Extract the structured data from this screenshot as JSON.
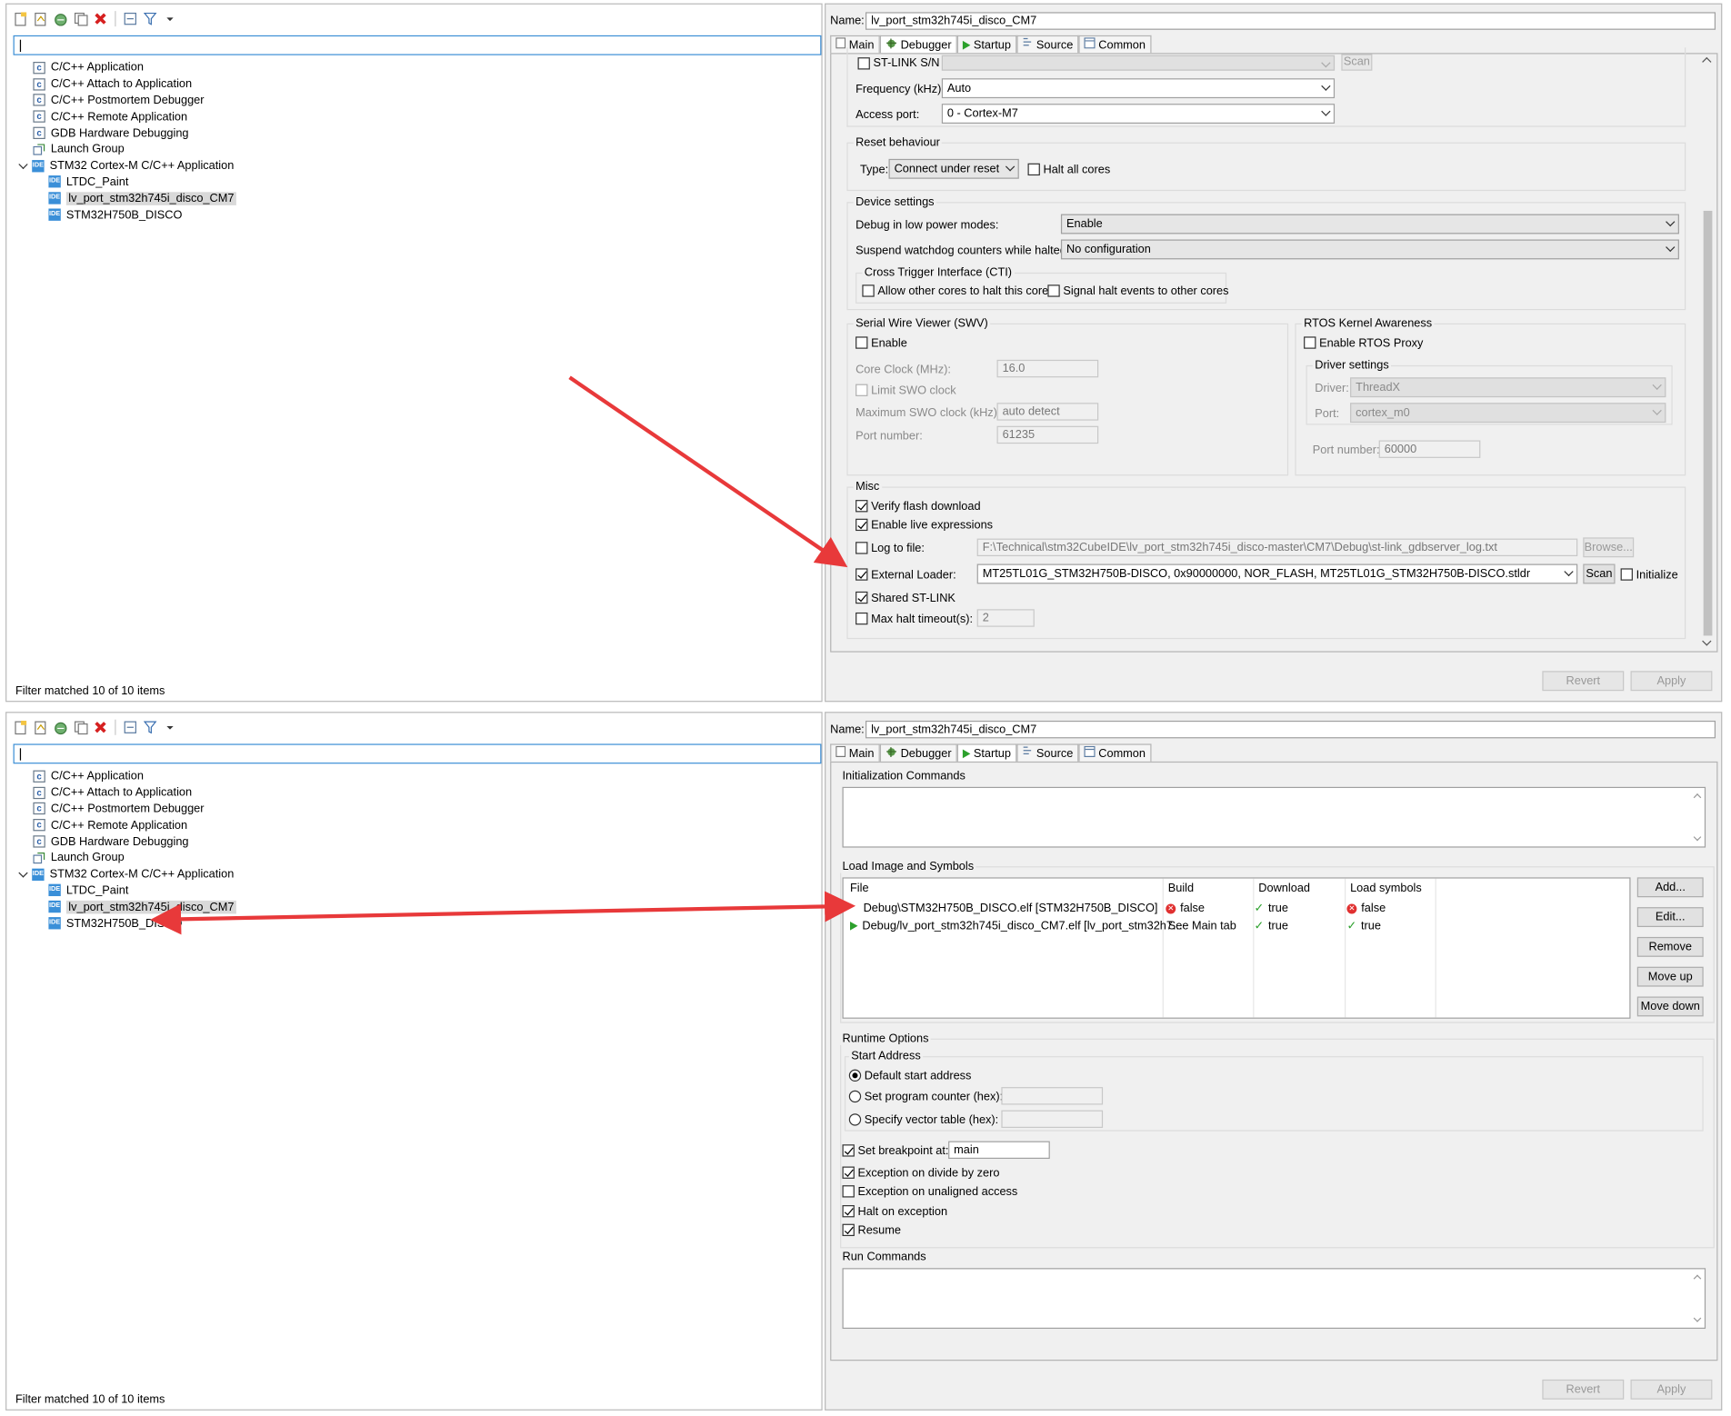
{
  "tree": {
    "items": [
      {
        "label": "C/C++ Application",
        "icon": "c-icon"
      },
      {
        "label": "C/C++ Attach to Application",
        "icon": "c-icon"
      },
      {
        "label": "C/C++ Postmortem Debugger",
        "icon": "c-icon"
      },
      {
        "label": "C/C++ Remote Application",
        "icon": "c-icon"
      },
      {
        "label": "GDB Hardware Debugging",
        "icon": "c-icon"
      },
      {
        "label": "Launch Group",
        "icon": "launch-group-icon"
      },
      {
        "label": "STM32 Cortex-M C/C++ Application",
        "icon": "ide-icon"
      },
      {
        "label": "LTDC_Paint",
        "icon": "ide-icon"
      },
      {
        "label": "lv_port_stm32h745i_disco_CM7",
        "icon": "ide-icon"
      },
      {
        "label": "STM32H750B_DISCO",
        "icon": "ide-icon"
      }
    ],
    "footer": "Filter matched 10 of 10 items"
  },
  "config": {
    "name_label": "Name:",
    "name_value": "lv_port_stm32h745i_disco_CM7",
    "tabs": [
      "Main",
      "Debugger",
      "Startup",
      "Source",
      "Common"
    ],
    "revert": "Revert",
    "apply": "Apply"
  },
  "debugger": {
    "stlink_sn": "ST-LINK S/N",
    "scan": "Scan",
    "frequency_label": "Frequency (kHz):",
    "frequency_value": "Auto",
    "access_port_label": "Access port:",
    "access_port_value": "0 - Cortex-M7",
    "reset_group": "Reset behaviour",
    "type_label": "Type:",
    "type_value": "Connect under reset",
    "halt_all": "Halt all cores",
    "device_group": "Device settings",
    "low_power_label": "Debug in low power modes:",
    "low_power_value": "Enable",
    "watchdog_label": "Suspend watchdog counters while halted:",
    "watchdog_value": "No configuration",
    "cti_group": "Cross Trigger Interface (CTI)",
    "cti_allow": "Allow other cores to halt this core",
    "cti_signal": "Signal halt events to other cores",
    "swv_group": "Serial Wire Viewer (SWV)",
    "swv_enable": "Enable",
    "core_clock_label": "Core Clock (MHz):",
    "core_clock_value": "16.0",
    "limit_swo": "Limit SWO clock",
    "max_swo_label": "Maximum SWO clock (kHz):",
    "max_swo_value": "auto detect",
    "port_number_label": "Port number:",
    "port_number_value": "61235",
    "rtos_group": "RTOS Kernel Awareness",
    "rtos_enable": "Enable RTOS Proxy",
    "driver_group": "Driver settings",
    "driver_label": "Driver:",
    "driver_value": "ThreadX",
    "port_label": "Port:",
    "port_value": "cortex_m0",
    "rtos_port_label": "Port number:",
    "rtos_port_value": "60000",
    "misc_group": "Misc",
    "verify_flash": "Verify flash download",
    "live_expr": "Enable live expressions",
    "log_to_file": "Log to file:",
    "log_path": "F:\\Technical\\stm32CubeIDE\\lv_port_stm32h745i_disco-master\\CM7\\Debug\\st-link_gdbserver_log.txt",
    "browse": "Browse...",
    "ext_loader": "External Loader:",
    "ext_loader_value": "MT25TL01G_STM32H750B-DISCO, 0x90000000, NOR_FLASH, MT25TL01G_STM32H750B-DISCO.stldr",
    "initialize": "Initialize",
    "shared_stlink": "Shared ST-LINK",
    "max_halt": "Max halt timeout(s):",
    "max_halt_value": "2"
  },
  "startup": {
    "init_cmds": "Initialization Commands",
    "load_group": "Load Image and Symbols",
    "cols": [
      "File",
      "Build",
      "Download",
      "Load symbols"
    ],
    "rows": [
      {
        "file": "Debug\\STM32H750B_DISCO.elf [STM32H750B_DISCO]",
        "build": "false",
        "download": "true",
        "symbols": "false"
      },
      {
        "file": "Debug/lv_port_stm32h745i_disco_CM7.elf [lv_port_stm32h7...",
        "build": "See Main tab",
        "download": "true",
        "symbols": "true"
      }
    ],
    "add": "Add...",
    "edit": "Edit...",
    "remove": "Remove",
    "move_up": "Move up",
    "move_down": "Move down",
    "runtime_group": "Runtime Options",
    "start_addr_group": "Start Address",
    "default_start": "Default start address",
    "set_pc": "Set program counter (hex):",
    "vector_table": "Specify vector table (hex):",
    "set_bp": "Set breakpoint at:",
    "bp_value": "main",
    "div_zero": "Exception on divide by zero",
    "unaligned": "Exception on unaligned access",
    "halt_exc": "Halt on exception",
    "resume": "Resume",
    "run_cmds": "Run Commands"
  },
  "colors": {
    "arrow": "#e8393a",
    "accent": "#3c8fd6"
  }
}
